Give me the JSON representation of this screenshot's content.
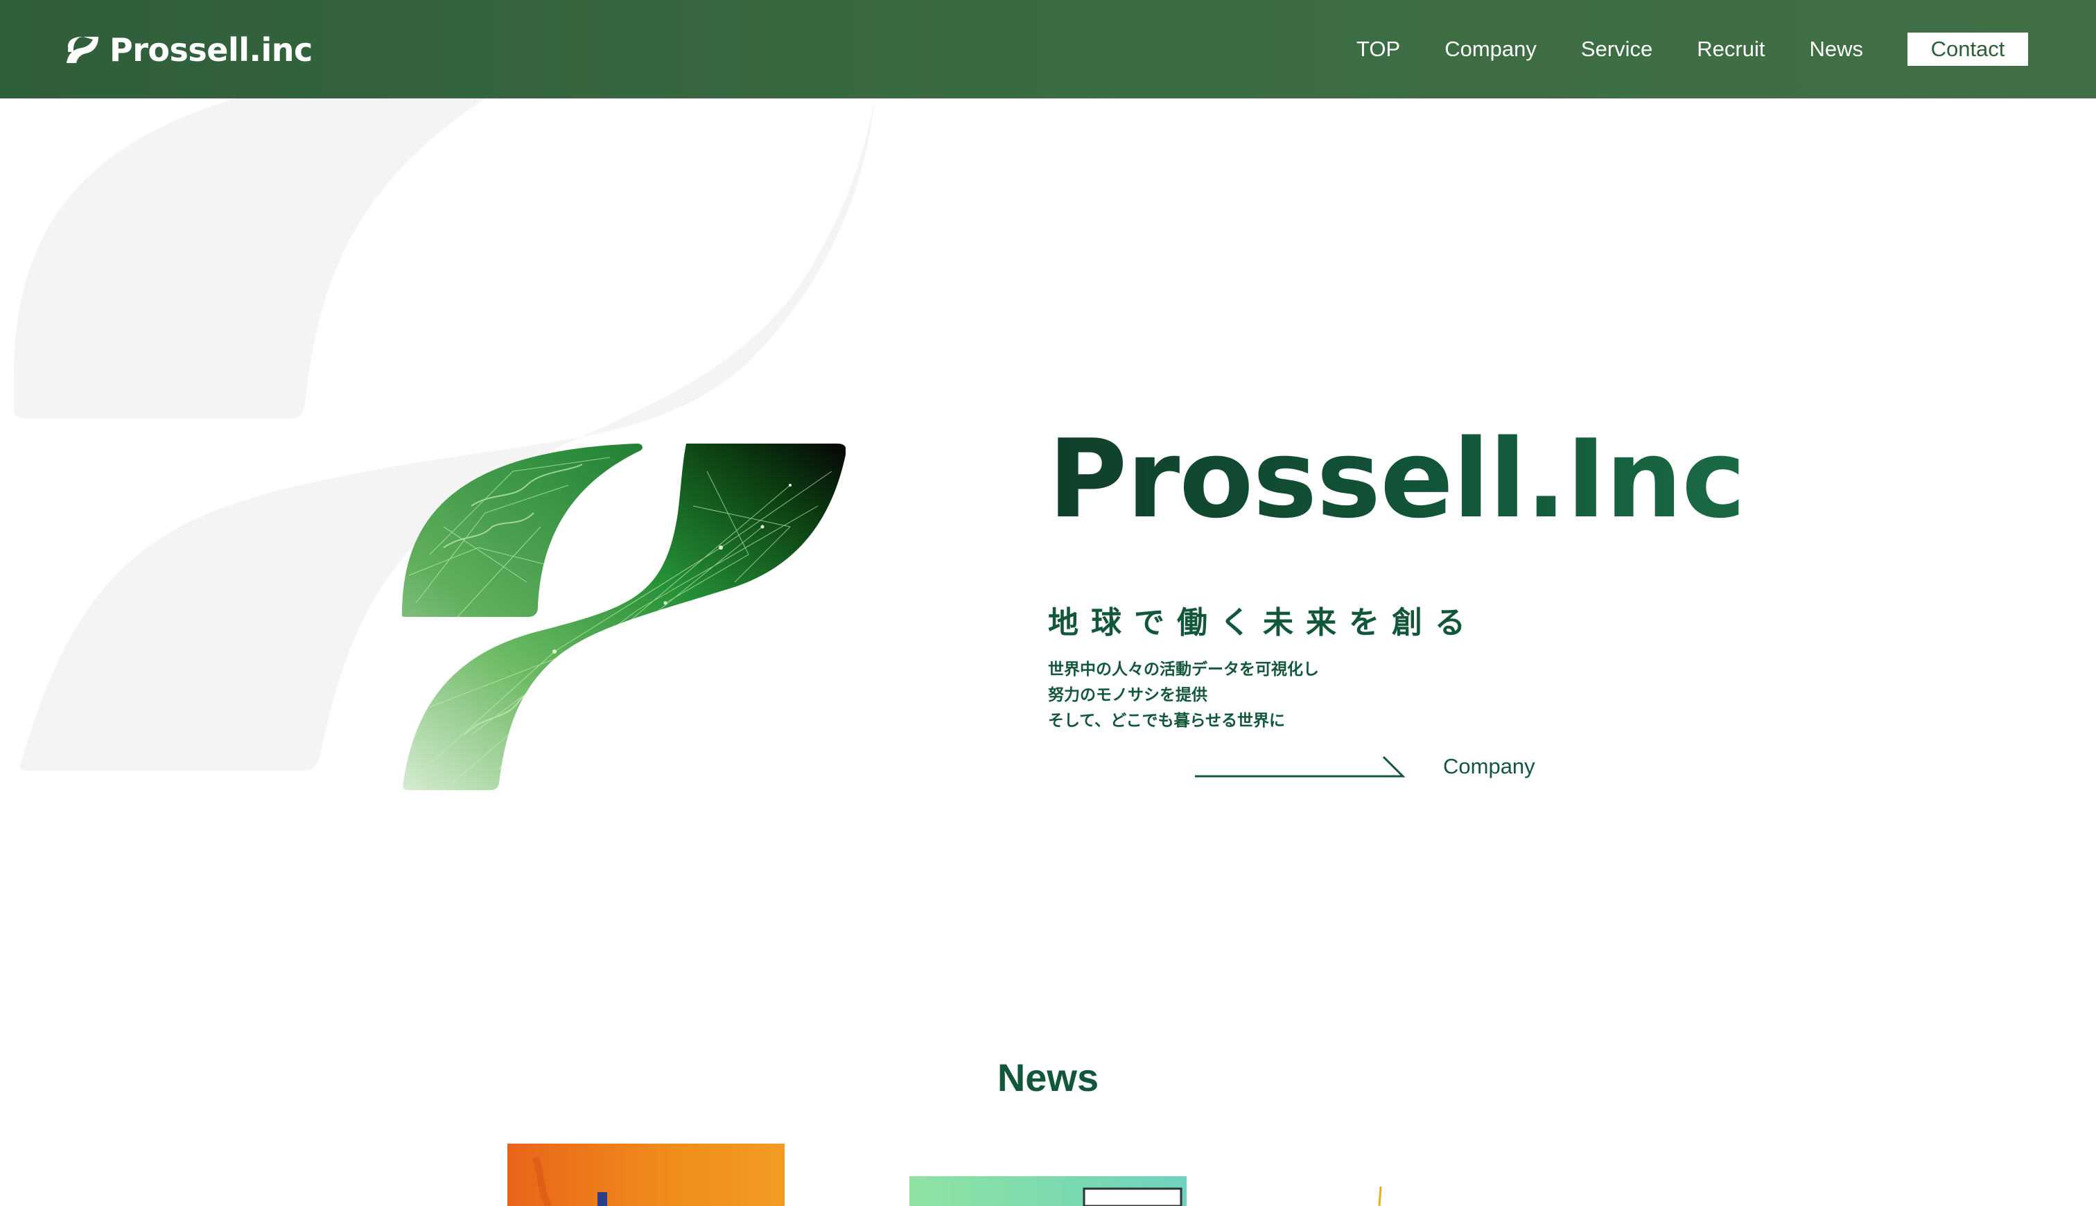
{
  "header": {
    "logo_text": "Prossell.inc",
    "nav": [
      {
        "label": "TOP"
      },
      {
        "label": "Company"
      },
      {
        "label": "Service"
      },
      {
        "label": "Recruit"
      },
      {
        "label": "News"
      }
    ],
    "contact_label": "Contact"
  },
  "hero": {
    "title": "Prossell.Inc",
    "tagline": "地球で働く未来を創る",
    "description": [
      "世界中の人々の活動データを可視化し",
      "努力のモノサシを提供",
      "そして、どこでも暮らせる世界に"
    ],
    "link_label": "Company"
  },
  "news": {
    "title": "News"
  },
  "colors": {
    "header_bg": "#3a6a41",
    "brand_green": "#13573a",
    "watermark": "#f4f4f4"
  },
  "icons": [
    "logo-mark-icon",
    "arrow-right-icon"
  ]
}
